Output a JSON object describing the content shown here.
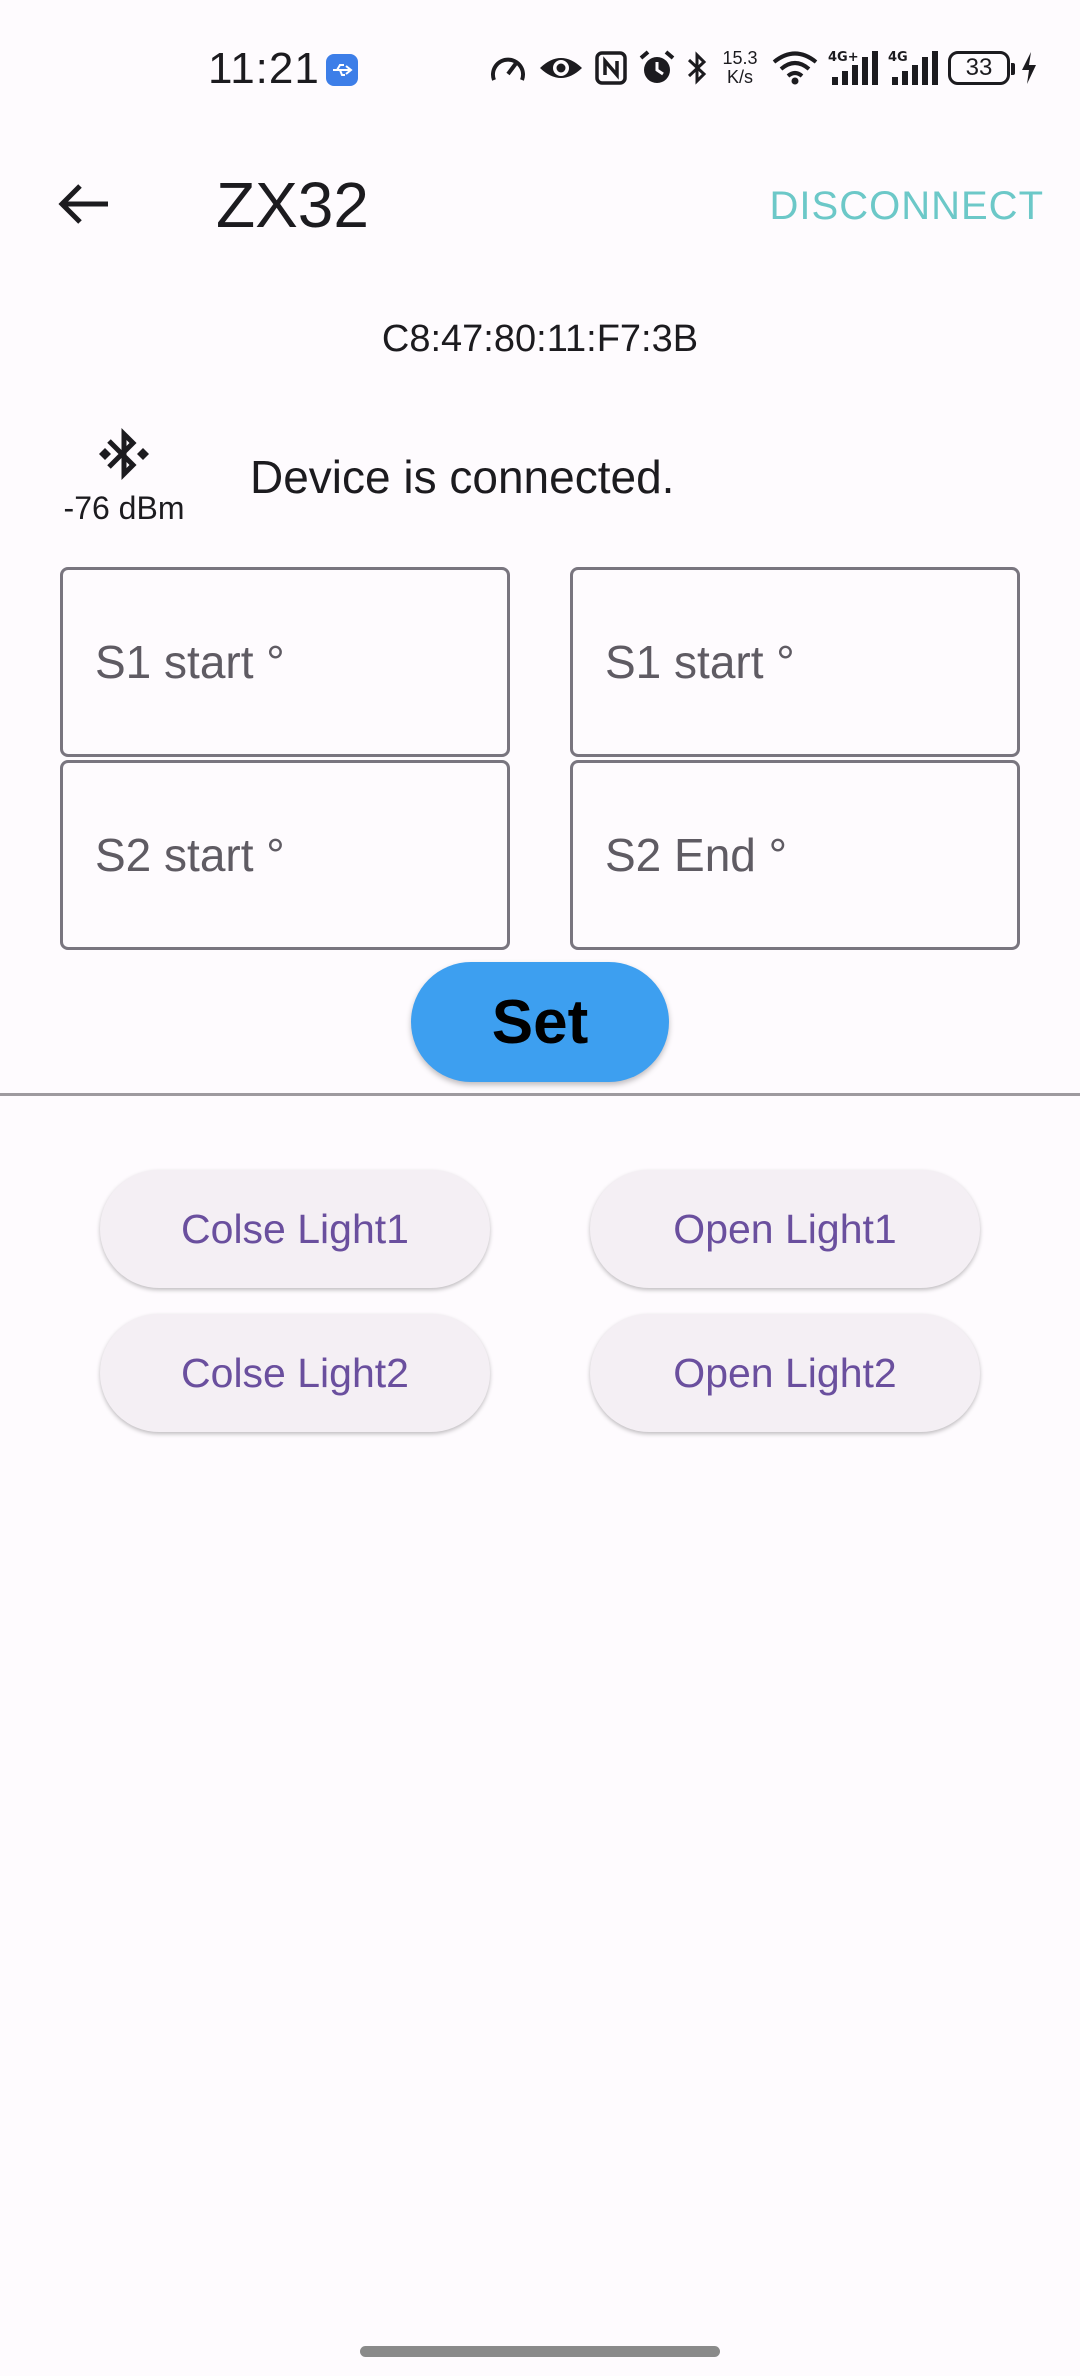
{
  "status_bar": {
    "time": "11:21",
    "net_speed_value": "15.3",
    "net_speed_unit": "K/s",
    "battery": "33",
    "icons": [
      "usb-icon",
      "speedometer-icon",
      "eye-icon",
      "nfc-icon",
      "alarm-icon",
      "bluetooth-icon",
      "wifi-icon",
      "signal-4g-icon",
      "signal-4g-icon",
      "battery-icon",
      "charging-icon"
    ]
  },
  "app_bar": {
    "title": "ZX32",
    "disconnect_label": "DISCONNECT",
    "back_icon": "arrow-back-icon"
  },
  "device": {
    "mac": "C8:47:80:11:F7:3B",
    "rssi": "-76 dBm",
    "status": "Device is connected.",
    "status_icon": "bluetooth-searching-icon"
  },
  "inputs": {
    "s1_start_a": "S1 start °",
    "s1_start_b": "S1 start °",
    "s2_start": "S2 start °",
    "s2_end": "S2 End °"
  },
  "set_label": "Set",
  "lights": {
    "close1": "Colse Light1",
    "open1": "Open Light1",
    "close2": "Colse Light2",
    "open2": "Open Light2"
  },
  "colors": {
    "accent_teal": "#6cc8c8",
    "set_button": "#3d9ff0",
    "light_button_text": "#6a4f9e",
    "background": "#fefbfe"
  }
}
